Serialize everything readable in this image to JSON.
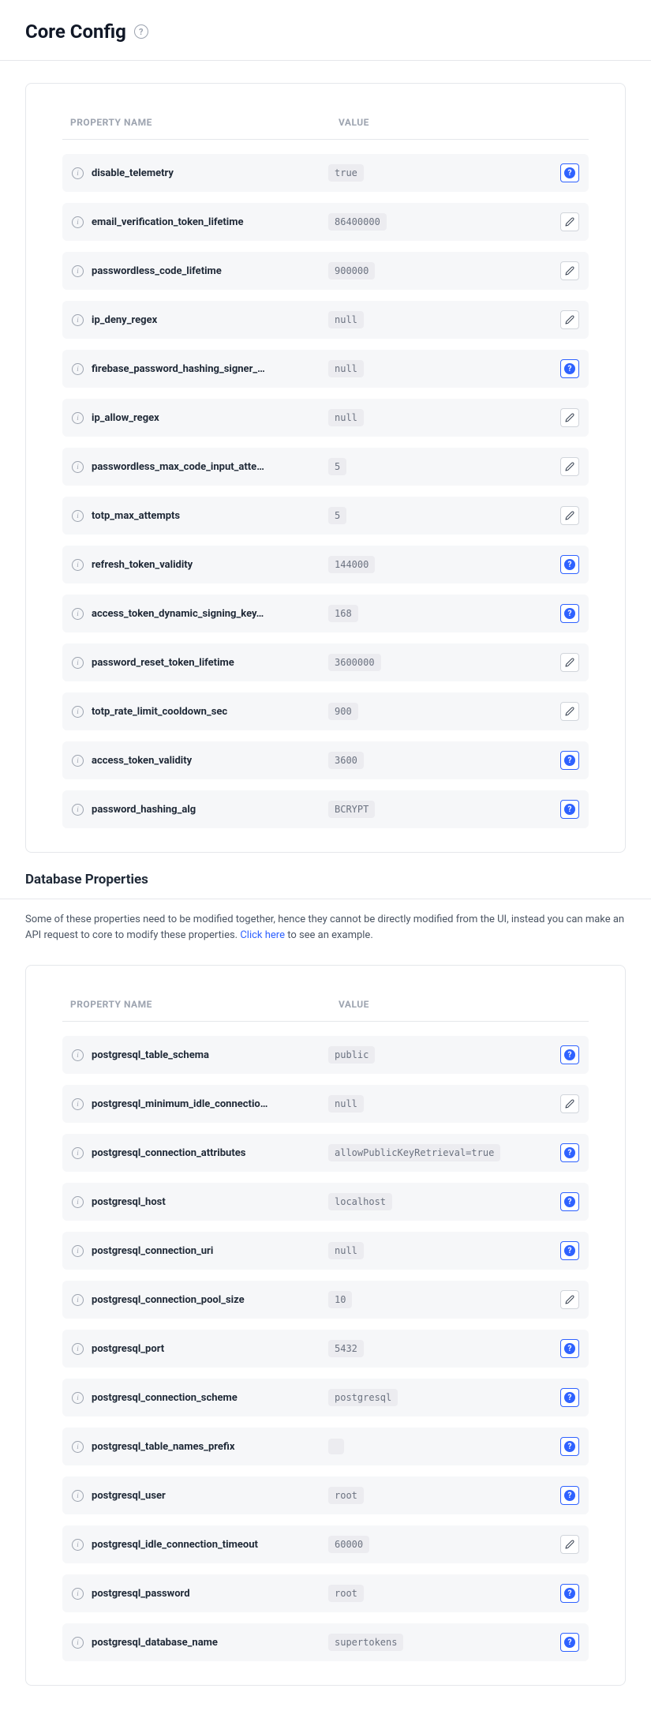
{
  "header": {
    "title": "Core Config"
  },
  "columns": {
    "name": "PROPERTY NAME",
    "value": "VALUE"
  },
  "coreConfig": [
    {
      "name": "disable_telemetry",
      "value": "true",
      "action": "help"
    },
    {
      "name": "email_verification_token_lifetime",
      "value": "86400000",
      "action": "edit"
    },
    {
      "name": "passwordless_code_lifetime",
      "value": "900000",
      "action": "edit"
    },
    {
      "name": "ip_deny_regex",
      "value": "null",
      "action": "edit"
    },
    {
      "name": "firebase_password_hashing_signer_…",
      "value": "null",
      "action": "help"
    },
    {
      "name": "ip_allow_regex",
      "value": "null",
      "action": "edit"
    },
    {
      "name": "passwordless_max_code_input_atte…",
      "value": "5",
      "action": "edit"
    },
    {
      "name": "totp_max_attempts",
      "value": "5",
      "action": "edit"
    },
    {
      "name": "refresh_token_validity",
      "value": "144000",
      "action": "help"
    },
    {
      "name": "access_token_dynamic_signing_key…",
      "value": "168",
      "action": "help"
    },
    {
      "name": "password_reset_token_lifetime",
      "value": "3600000",
      "action": "edit"
    },
    {
      "name": "totp_rate_limit_cooldown_sec",
      "value": "900",
      "action": "edit"
    },
    {
      "name": "access_token_validity",
      "value": "3600",
      "action": "help"
    },
    {
      "name": "password_hashing_alg",
      "value": "BCRYPT",
      "action": "help"
    }
  ],
  "dbSection": {
    "title": "Database Properties",
    "descPre": "Some of these properties need to be modified together, hence they cannot be directly modified from the UI, instead you can make an API request to core to modify these properties. ",
    "linkText": "Click here",
    "descPost": " to see an example."
  },
  "dbConfig": [
    {
      "name": "postgresql_table_schema",
      "value": "public",
      "action": "help"
    },
    {
      "name": "postgresql_minimum_idle_connectio…",
      "value": "null",
      "action": "edit"
    },
    {
      "name": "postgresql_connection_attributes",
      "value": "allowPublicKeyRetrieval=true",
      "action": "help"
    },
    {
      "name": "postgresql_host",
      "value": "localhost",
      "action": "help"
    },
    {
      "name": "postgresql_connection_uri",
      "value": "null",
      "action": "help"
    },
    {
      "name": "postgresql_connection_pool_size",
      "value": "10",
      "action": "edit"
    },
    {
      "name": "postgresql_port",
      "value": "5432",
      "action": "help"
    },
    {
      "name": "postgresql_connection_scheme",
      "value": "postgresql",
      "action": "help"
    },
    {
      "name": "postgresql_table_names_prefix",
      "value": "",
      "action": "help"
    },
    {
      "name": "postgresql_user",
      "value": "root",
      "action": "help"
    },
    {
      "name": "postgresql_idle_connection_timeout",
      "value": "60000",
      "action": "edit"
    },
    {
      "name": "postgresql_password",
      "value": "root",
      "action": "help"
    },
    {
      "name": "postgresql_database_name",
      "value": "supertokens",
      "action": "help"
    }
  ]
}
